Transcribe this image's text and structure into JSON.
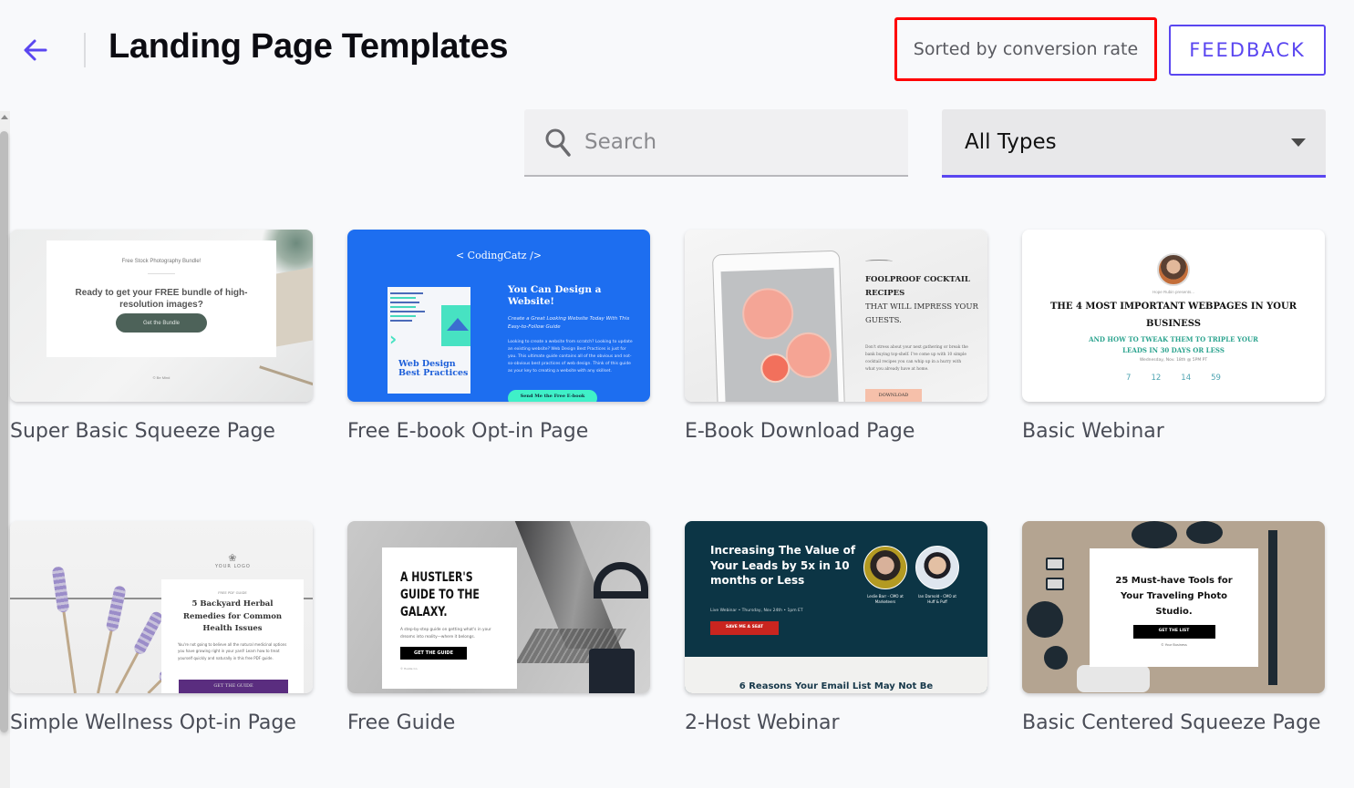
{
  "header": {
    "back_icon": "arrow-left-icon",
    "title": "Landing Page Templates",
    "sort_label": "Sorted by conversion rate",
    "feedback_label": "FEEDBACK",
    "accent_color": "#5a46f0"
  },
  "filters": {
    "search": {
      "icon": "search-icon",
      "placeholder": "Search",
      "value": ""
    },
    "type_select": {
      "value": "All Types",
      "icon": "caret-down-icon"
    }
  },
  "templates": [
    {
      "name": "Super Basic Squeeze Page",
      "preview": {
        "kicker": "Free Stock Photography Bundle!",
        "headline": "Ready to get your FREE bundle of high-resolution images?",
        "button": "Get the Bundle",
        "footer": "© Be Mind"
      }
    },
    {
      "name": "Free E-book Opt-in Page",
      "preview": {
        "brand": "< CodingCatz />",
        "book_title": "Web Design Best Practices",
        "headline": "You Can Design a Website!",
        "subheadline": "Create a Great Looking Website Today With This Easy-to-Follow Guide",
        "body": "Looking to create a website from scratch? Looking to update an existing website? Web Design Best Practices is just for you. This ultimate guide contains all of the obvious and not-so-obvious best practices of web design. Think of this guide as your key to creating a website with any skillset.",
        "button": "Send Me the Free E-book"
      }
    },
    {
      "name": "E-Book Download Page",
      "preview": {
        "headline_bold": "FOOLPROOF COCKTAIL RECIPES",
        "headline_rest": "THAT WILL IMPRESS YOUR GUESTS.",
        "body": "Don't stress about your next gathering or break the bank buying top-shelf. I've come up with 10 simple cocktail recipes you can whip up in a hurry with what you already have at home.",
        "button": "DOWNLOAD"
      }
    },
    {
      "name": "Basic Webinar",
      "preview": {
        "presenter": "Hope Rubin presents...",
        "headline": "THE 4 MOST IMPORTANT WEBPAGES IN YOUR BUSINESS",
        "subheadline": "AND HOW TO TWEAK THEM TO TRIPLE YOUR LEADS IN 30 DAYS OR LESS",
        "date": "Wednesday, Nov. 18th @ 5PM PT",
        "countdown": [
          "7",
          "12",
          "14",
          "59"
        ]
      }
    },
    {
      "name": "Simple Wellness Opt-in Page",
      "preview": {
        "logo": "YOUR LOGO",
        "kicker": "FREE PDF GUIDE",
        "headline": "5 Backyard Herbal Remedies for Common Health Issues",
        "body": "You're not going to believe all the natural medicinal options you have growing right in your yard! Learn how to treat yourself quickly and naturally in this free PDF guide.",
        "button": "GET THE GUIDE"
      }
    },
    {
      "name": "Free Guide",
      "preview": {
        "headline": "A HUSTLER'S GUIDE TO THE GALAXY.",
        "body": "A step-by-step guide on getting what's in your dreams into reality—where it belongs.",
        "button": "GET THE GUIDE",
        "footer": "© Hustle Co."
      }
    },
    {
      "name": "2-Host Webinar",
      "preview": {
        "headline": "Increasing The Value of Your Leads by 5x in 10 months or Less",
        "meta": "Live Webinar • Thursday, Nov 24th • 1pm ET",
        "button": "SAVE ME A SEAT",
        "host1": "Leslie Barr - CMO at Marketeers",
        "host2": "Ian Darnold - CMO at Huff & Puff",
        "section_title": "6 Reasons Your Email List May Not Be"
      }
    },
    {
      "name": "Basic Centered Squeeze Page",
      "preview": {
        "headline": "25 Must-have Tools for Your Traveling Photo Studio.",
        "button": "GET THE LIST",
        "footer": "© Your Business"
      }
    }
  ]
}
